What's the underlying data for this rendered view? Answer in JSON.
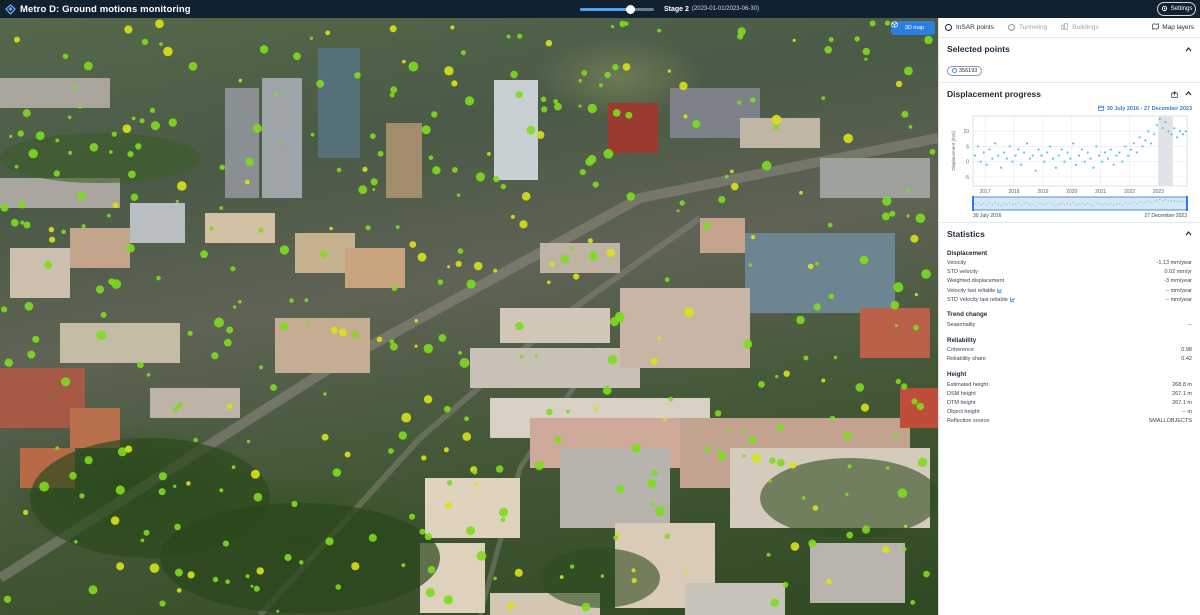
{
  "app": {
    "title": "Metro D: Ground motions monitoring"
  },
  "stage": {
    "label": "Stage 2",
    "range": "(2023-01-01/2023-06-30)",
    "progress_percent": 66
  },
  "settings": {
    "label": "Settings"
  },
  "map": {
    "mode_button": "3D map"
  },
  "tabs": [
    {
      "label": "InSAR points",
      "active": true
    },
    {
      "label": "Tunneling",
      "active": false
    },
    {
      "label": "Buildings",
      "active": false
    }
  ],
  "map_layers_label": "Map layers",
  "selected_points": {
    "title": "Selected points",
    "chip": "356193"
  },
  "displacement": {
    "title": "Displacement progress",
    "date_range": "30 July 2016 - 27 December 2023",
    "range_start": "30 July 2016",
    "range_end": "27 December 2023"
  },
  "chart_data": {
    "type": "scatter",
    "ylabel": "Displacement [mm]",
    "yticks": [
      10,
      5,
      0,
      -5
    ],
    "ylim": [
      -8,
      15
    ],
    "xticks": [
      "2017",
      "2018",
      "2019",
      "2020",
      "2021",
      "2022",
      "2023"
    ],
    "xlim": [
      2016.58,
      2023.99
    ],
    "highlight": [
      2023.0,
      2023.5
    ],
    "series": [
      {
        "x": [
          2016.65,
          2016.75,
          2016.85,
          2016.95,
          2017.05,
          2017.15,
          2017.25,
          2017.35,
          2017.45,
          2017.55,
          2017.65,
          2017.75,
          2017.85,
          2017.95,
          2018.05,
          2018.15,
          2018.25,
          2018.35,
          2018.45,
          2018.55,
          2018.65,
          2018.75,
          2018.85,
          2018.95,
          2019.05,
          2019.15,
          2019.25,
          2019.35,
          2019.45,
          2019.55,
          2019.65,
          2019.75,
          2019.85,
          2019.95,
          2020.05,
          2020.15,
          2020.25,
          2020.35,
          2020.45,
          2020.55,
          2020.65,
          2020.75,
          2020.85,
          2020.95,
          2021.05,
          2021.15,
          2021.25,
          2021.35,
          2021.45,
          2021.55,
          2021.65,
          2021.75,
          2021.85,
          2021.95,
          2022.05,
          2022.15,
          2022.25,
          2022.35,
          2022.45,
          2022.55,
          2022.65,
          2022.75,
          2022.85,
          2022.95,
          2023.05,
          2023.15,
          2023.25,
          2023.35,
          2023.45,
          2023.55,
          2023.65,
          2023.75,
          2023.85,
          2023.95
        ],
        "y": [
          2,
          5,
          0,
          3,
          -1,
          4,
          1,
          6,
          2,
          -2,
          3,
          1,
          5,
          0,
          2,
          4,
          -1,
          3,
          6,
          1,
          2,
          -3,
          4,
          2,
          0,
          3,
          5,
          1,
          -2,
          2,
          4,
          0,
          3,
          1,
          6,
          -1,
          2,
          4,
          0,
          3,
          1,
          -2,
          5,
          2,
          0,
          3,
          1,
          4,
          -1,
          2,
          3,
          0,
          5,
          2,
          4,
          6,
          3,
          8,
          5,
          7,
          10,
          6,
          9,
          12,
          14,
          11,
          13,
          10,
          9,
          11,
          8,
          10,
          9,
          10
        ]
      }
    ],
    "overview": {
      "xlim": [
        2016.58,
        2023.99
      ],
      "window": [
        2016.58,
        2023.99
      ]
    }
  },
  "statistics": {
    "title": "Statistics",
    "groups": [
      {
        "title": "Displacement",
        "rows": [
          {
            "label": "Velocity",
            "value": "-1.13 mm/year"
          },
          {
            "label": "STD velocity",
            "value": "0.02 mm/yr"
          },
          {
            "label": "Weighted displacement",
            "value": "-3 mm/year"
          },
          {
            "label": "Velocity last reliable",
            "value": "-- mm/year"
          },
          {
            "label": "STD Velocity last reliable",
            "value": "-- mm/year"
          }
        ]
      },
      {
        "title": "Trend change",
        "rows": [
          {
            "label": "Seasonality",
            "value": "--"
          }
        ]
      },
      {
        "title": "Reliability",
        "rows": [
          {
            "label": "Coherence",
            "value": "0.98"
          },
          {
            "label": "Reliability share",
            "value": "0.42"
          }
        ]
      },
      {
        "title": "Height",
        "rows": [
          {
            "label": "Estimated height",
            "value": "268.8 m"
          },
          {
            "label": "DSM height",
            "value": "267.1 m"
          },
          {
            "label": "DTM height",
            "value": "267.1 m"
          },
          {
            "label": "Object height",
            "value": "-- m"
          },
          {
            "label": "Reflection source",
            "value": "SMALLOBJECTS"
          }
        ]
      }
    ]
  },
  "colors": {
    "accent": "#2b7fe0",
    "topbar": "#102130",
    "point_green": "#7ddc1f",
    "point_yellow": "#d8e21a",
    "chart_point": "#5cc4e6"
  }
}
